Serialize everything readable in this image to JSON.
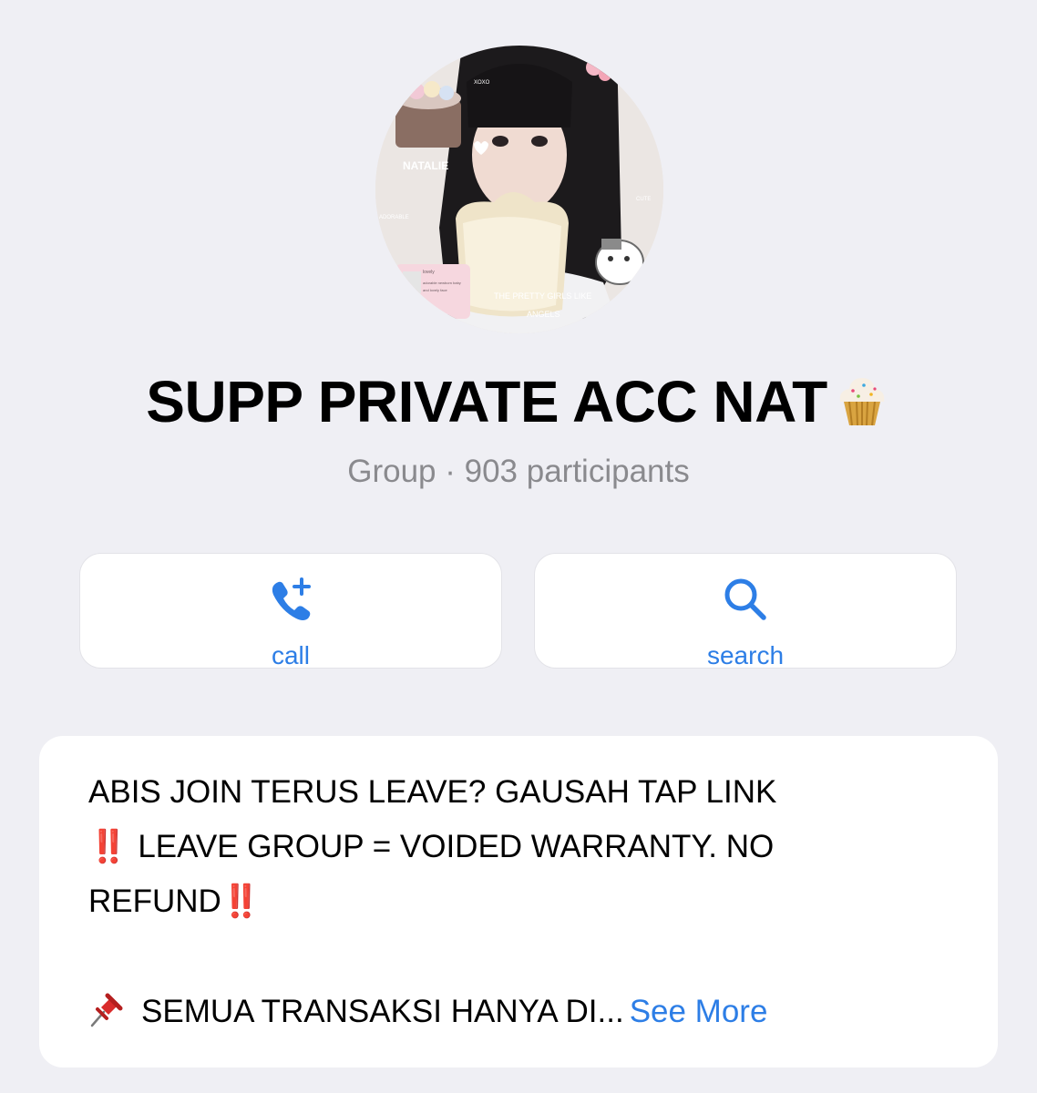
{
  "profile": {
    "avatar_labels": [
      "NATALIE",
      "XOXO",
      "ADORABLE",
      "CUTE",
      "THE PRETTY GIRLS LIKE",
      "ANGELS",
      "lovely",
      "adorable newborn baby and lovely face"
    ],
    "name": "SUPP PRIVATE ACC NAT",
    "name_emoji_icon": "cupcake-icon",
    "subtitle": "Group · 903 participants"
  },
  "actions": {
    "call_label": "call",
    "call_icon": "phone-plus-icon",
    "search_label": "search",
    "search_icon": "magnifier-icon"
  },
  "description": {
    "line1": "ABIS JOIN TERUS LEAVE? GAUSAH TAP LINK",
    "line2_prefix": "‼️",
    "line2": " LEAVE GROUP = VOIDED WARRANTY. NO",
    "line3": "REFUND",
    "line3_suffix": "‼️",
    "line4_icon": "pushpin-icon",
    "line4": "SEMUA TRANSAKSI HANYA DI...",
    "see_more": "See More"
  },
  "colors": {
    "background": "#efeff4",
    "accent": "#2d7ee6",
    "secondary_text": "#8a8a8e",
    "warning": "#e0322b"
  }
}
